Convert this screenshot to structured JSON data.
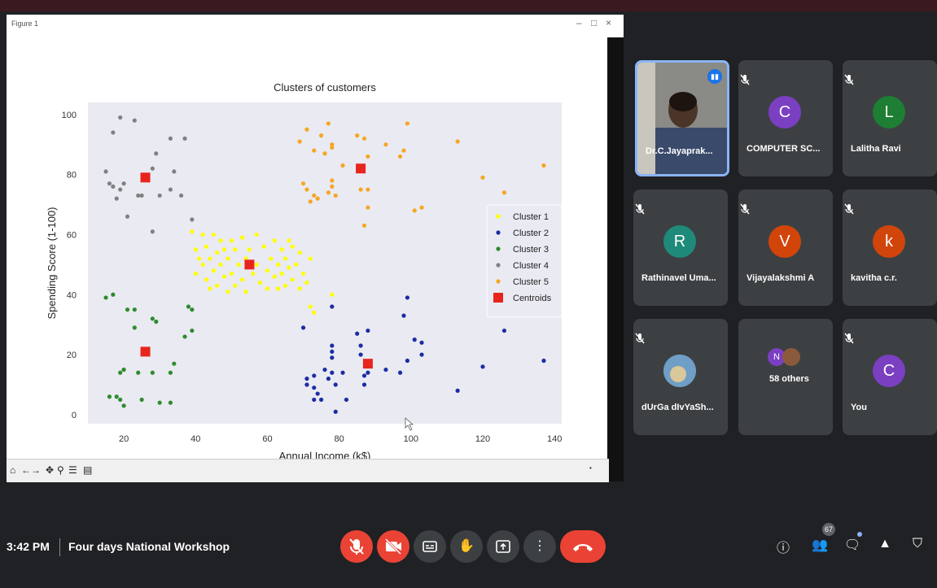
{
  "window": {
    "title": "Figure 1",
    "controls": [
      "–",
      "□",
      "×"
    ]
  },
  "chart_data": {
    "type": "scatter",
    "title": "Clusters of customers",
    "xlabel": "Annual Income (k$)",
    "ylabel": "Spending Score (1-100)",
    "xlim": [
      10,
      142
    ],
    "ylim": [
      -3,
      104
    ],
    "xticks": [
      20,
      40,
      60,
      80,
      100,
      120,
      140
    ],
    "yticks": [
      0,
      20,
      40,
      60,
      80,
      100
    ],
    "grid": false,
    "legend_position": "center-right",
    "background": "#eaeaf2",
    "series": [
      {
        "name": "Cluster 1",
        "color": "#ffff00",
        "points": [
          [
            39,
            61
          ],
          [
            40,
            55
          ],
          [
            40,
            47
          ],
          [
            41,
            52
          ],
          [
            42,
            60
          ],
          [
            42,
            50
          ],
          [
            43,
            45
          ],
          [
            43,
            56
          ],
          [
            44,
            52
          ],
          [
            44,
            42
          ],
          [
            45,
            60
          ],
          [
            45,
            48
          ],
          [
            46,
            54
          ],
          [
            46,
            43
          ],
          [
            47,
            58
          ],
          [
            47,
            50
          ],
          [
            48,
            46
          ],
          [
            48,
            55
          ],
          [
            49,
            41
          ],
          [
            49,
            52
          ],
          [
            50,
            58
          ],
          [
            50,
            47
          ],
          [
            51,
            43
          ],
          [
            51,
            55
          ],
          [
            52,
            50
          ],
          [
            53,
            59
          ],
          [
            53,
            45
          ],
          [
            54,
            52
          ],
          [
            54,
            41
          ],
          [
            55,
            55
          ],
          [
            56,
            47
          ],
          [
            57,
            60
          ],
          [
            57,
            50
          ],
          [
            58,
            44
          ],
          [
            59,
            56
          ],
          [
            60,
            48
          ],
          [
            60,
            42
          ],
          [
            61,
            52
          ],
          [
            62,
            58
          ],
          [
            62,
            46
          ],
          [
            63,
            50
          ],
          [
            63,
            42
          ],
          [
            64,
            55
          ],
          [
            64,
            47
          ],
          [
            65,
            52
          ],
          [
            65,
            43
          ],
          [
            66,
            58
          ],
          [
            66,
            49
          ],
          [
            67,
            45
          ],
          [
            67,
            56
          ],
          [
            68,
            50
          ],
          [
            69,
            42
          ],
          [
            69,
            54
          ],
          [
            70,
            47
          ],
          [
            71,
            44
          ],
          [
            72,
            52
          ],
          [
            73,
            34
          ],
          [
            72,
            36
          ],
          [
            78,
            40
          ]
        ]
      },
      {
        "name": "Cluster 2",
        "color": "#1a2da3",
        "points": [
          [
            70,
            29
          ],
          [
            71,
            12
          ],
          [
            71,
            10
          ],
          [
            73,
            5
          ],
          [
            73,
            9
          ],
          [
            73,
            13
          ],
          [
            74,
            7
          ],
          [
            75,
            5
          ],
          [
            76,
            15
          ],
          [
            77,
            12
          ],
          [
            78,
            14
          ],
          [
            78,
            19
          ],
          [
            78,
            21
          ],
          [
            78,
            23
          ],
          [
            79,
            1
          ],
          [
            79,
            10
          ],
          [
            78,
            36
          ],
          [
            81,
            14
          ],
          [
            82,
            5
          ],
          [
            85,
            27
          ],
          [
            86,
            20
          ],
          [
            86,
            23
          ],
          [
            87,
            10
          ],
          [
            87,
            13
          ],
          [
            88,
            14
          ],
          [
            88,
            28
          ],
          [
            93,
            15
          ],
          [
            97,
            14
          ],
          [
            98,
            33
          ],
          [
            99,
            18
          ],
          [
            99,
            39
          ],
          [
            101,
            25
          ],
          [
            103,
            20
          ],
          [
            103,
            24
          ],
          [
            113,
            8
          ],
          [
            120,
            16
          ],
          [
            126,
            28
          ],
          [
            137,
            18
          ]
        ]
      },
      {
        "name": "Cluster 3",
        "color": "#2e8b2e",
        "points": [
          [
            15,
            39
          ],
          [
            16,
            6
          ],
          [
            17,
            40
          ],
          [
            18,
            6
          ],
          [
            19,
            5
          ],
          [
            19,
            14
          ],
          [
            20,
            3
          ],
          [
            20,
            15
          ],
          [
            20,
            15
          ],
          [
            21,
            35
          ],
          [
            23,
            29
          ],
          [
            23,
            35
          ],
          [
            24,
            14
          ],
          [
            25,
            5
          ],
          [
            28,
            32
          ],
          [
            28,
            14
          ],
          [
            29,
            31
          ],
          [
            30,
            4
          ],
          [
            33,
            14
          ],
          [
            33,
            4
          ],
          [
            34,
            17
          ],
          [
            37,
            26
          ],
          [
            38,
            36
          ],
          [
            39,
            28
          ],
          [
            39,
            35
          ]
        ]
      },
      {
        "name": "Cluster 4",
        "color": "#808080",
        "points": [
          [
            15,
            81
          ],
          [
            16,
            77
          ],
          [
            17,
            76
          ],
          [
            17,
            94
          ],
          [
            18,
            72
          ],
          [
            19,
            99
          ],
          [
            19,
            75
          ],
          [
            20,
            77
          ],
          [
            21,
            66
          ],
          [
            23,
            98
          ],
          [
            24,
            73
          ],
          [
            25,
            73
          ],
          [
            28,
            61
          ],
          [
            28,
            82
          ],
          [
            29,
            87
          ],
          [
            30,
            73
          ],
          [
            33,
            92
          ],
          [
            33,
            75
          ],
          [
            34,
            81
          ],
          [
            36,
            73
          ],
          [
            37,
            92
          ],
          [
            39,
            65
          ]
        ]
      },
      {
        "name": "Cluster 5",
        "color": "#f5a623",
        "points": [
          [
            69,
            91
          ],
          [
            70,
            77
          ],
          [
            71,
            95
          ],
          [
            71,
            75
          ],
          [
            72,
            71
          ],
          [
            73,
            88
          ],
          [
            73,
            73
          ],
          [
            74,
            72
          ],
          [
            75,
            93
          ],
          [
            76,
            87
          ],
          [
            77,
            97
          ],
          [
            77,
            74
          ],
          [
            78,
            90
          ],
          [
            78,
            76
          ],
          [
            78,
            89
          ],
          [
            78,
            78
          ],
          [
            79,
            73
          ],
          [
            81,
            83
          ],
          [
            85,
            93
          ],
          [
            86,
            75
          ],
          [
            87,
            63
          ],
          [
            87,
            92
          ],
          [
            88,
            86
          ],
          [
            88,
            69
          ],
          [
            88,
            75
          ],
          [
            93,
            90
          ],
          [
            97,
            86
          ],
          [
            98,
            88
          ],
          [
            99,
            97
          ],
          [
            101,
            68
          ],
          [
            103,
            69
          ],
          [
            113,
            91
          ],
          [
            120,
            79
          ],
          [
            126,
            74
          ],
          [
            137,
            83
          ]
        ]
      }
    ],
    "centroids": {
      "name": "Centroids",
      "color": "#e8251d",
      "points": [
        [
          26,
          79
        ],
        [
          55,
          50
        ],
        [
          86,
          82
        ],
        [
          88,
          17
        ],
        [
          26,
          21
        ]
      ]
    }
  },
  "toolbar": {
    "icons": [
      "home-icon",
      "back-icon",
      "forward-icon",
      "pan-icon",
      "zoom-icon",
      "configure-icon",
      "save-icon"
    ]
  },
  "participants": [
    {
      "name": "Dr.C.Jayaprak...",
      "initial": "",
      "color": "#7a7a7a",
      "active": true
    },
    {
      "name": "COMPUTER SC...",
      "initial": "C",
      "color": "#7b3fc2"
    },
    {
      "name": "Lalitha Ravi",
      "initial": "L",
      "color": "#1e7e34"
    },
    {
      "name": "Rathinavel Uma...",
      "initial": "R",
      "color": "#1e8a7a"
    },
    {
      "name": "Vijayalakshmi A",
      "initial": "V",
      "color": "#d2450a"
    },
    {
      "name": "kavitha c.r.",
      "initial": "k",
      "color": "#d2450a"
    },
    {
      "name": "dUrGa dIvYaSh...",
      "initial": "",
      "color": "#4a90c0"
    },
    {
      "name": "58 others",
      "initial": "N",
      "color": "#7b3fc2"
    },
    {
      "name": "You",
      "initial": "C",
      "color": "#7b3fc2"
    }
  ],
  "bottom_bar": {
    "time": "3:42 PM",
    "meeting_title": "Four days National Workshop",
    "people_count": "67"
  }
}
